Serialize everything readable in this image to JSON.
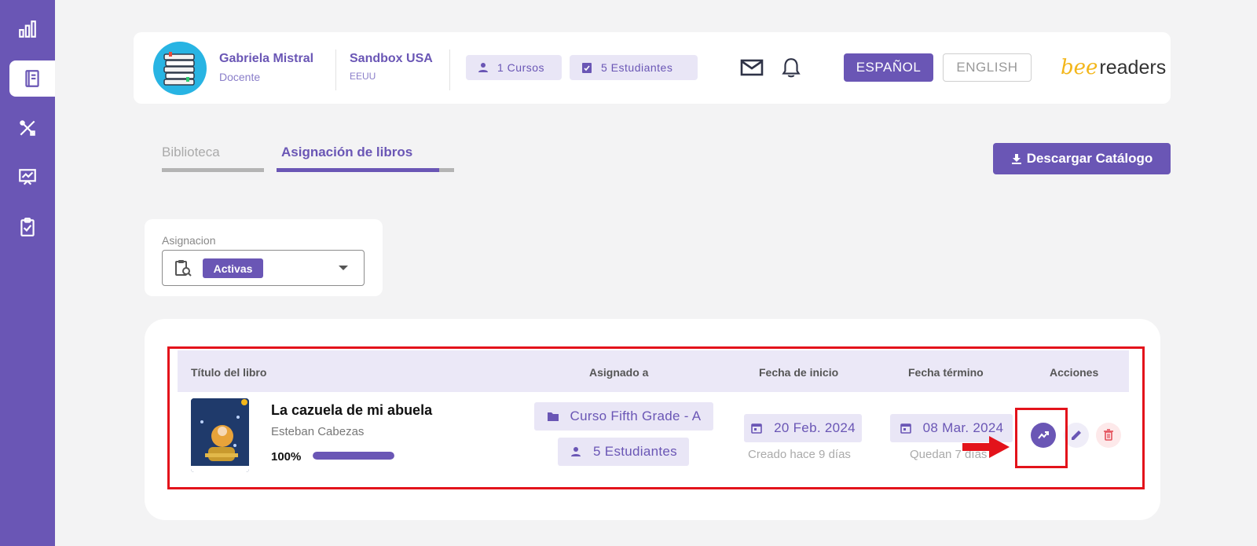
{
  "sidebar": {
    "items": [
      {
        "icon": "bar-chart-icon"
      },
      {
        "icon": "book-icon",
        "active": true
      },
      {
        "icon": "tools-icon"
      },
      {
        "icon": "presentation-chart-icon"
      },
      {
        "icon": "clipboard-check-icon"
      }
    ]
  },
  "header": {
    "user_name": "Gabriela Mistral",
    "user_role": "Docente",
    "org_name": "Sandbox USA",
    "org_country": "EEUU",
    "courses_chip": "1 Cursos",
    "students_chip": "5 Estudiantes",
    "lang_es": "ESPAÑOL",
    "lang_en": "ENGLISH",
    "logo_bee": "bee",
    "logo_readers": "readers"
  },
  "tabs": {
    "biblioteca": "Biblioteca",
    "asignacion": "Asignación de libros",
    "active": "asignacion"
  },
  "download_button": "Descargar Catálogo",
  "filter": {
    "label": "Asignacion",
    "selected": "Activas"
  },
  "table": {
    "headers": {
      "titulo": "Título del libro",
      "asignado": "Asignado a",
      "inicio": "Fecha de inicio",
      "termino": "Fecha término",
      "acciones": "Acciones"
    },
    "rows": [
      {
        "title": "La cazuela de mi abuela",
        "author": "Esteban Cabezas",
        "progress_label": "100%",
        "progress": 1.0,
        "course": "Curso Fifth Grade - A",
        "students": "5 Estudiantes",
        "start_date": "20 Feb. 2024",
        "start_sub": "Creado hace 9 días",
        "end_date": "08 Mar. 2024",
        "end_sub": "Quedan 7 días"
      }
    ]
  },
  "colors": {
    "primary": "#6a56b5",
    "accent_light": "#e9e6f6",
    "highlight_red": "#e3131b"
  }
}
